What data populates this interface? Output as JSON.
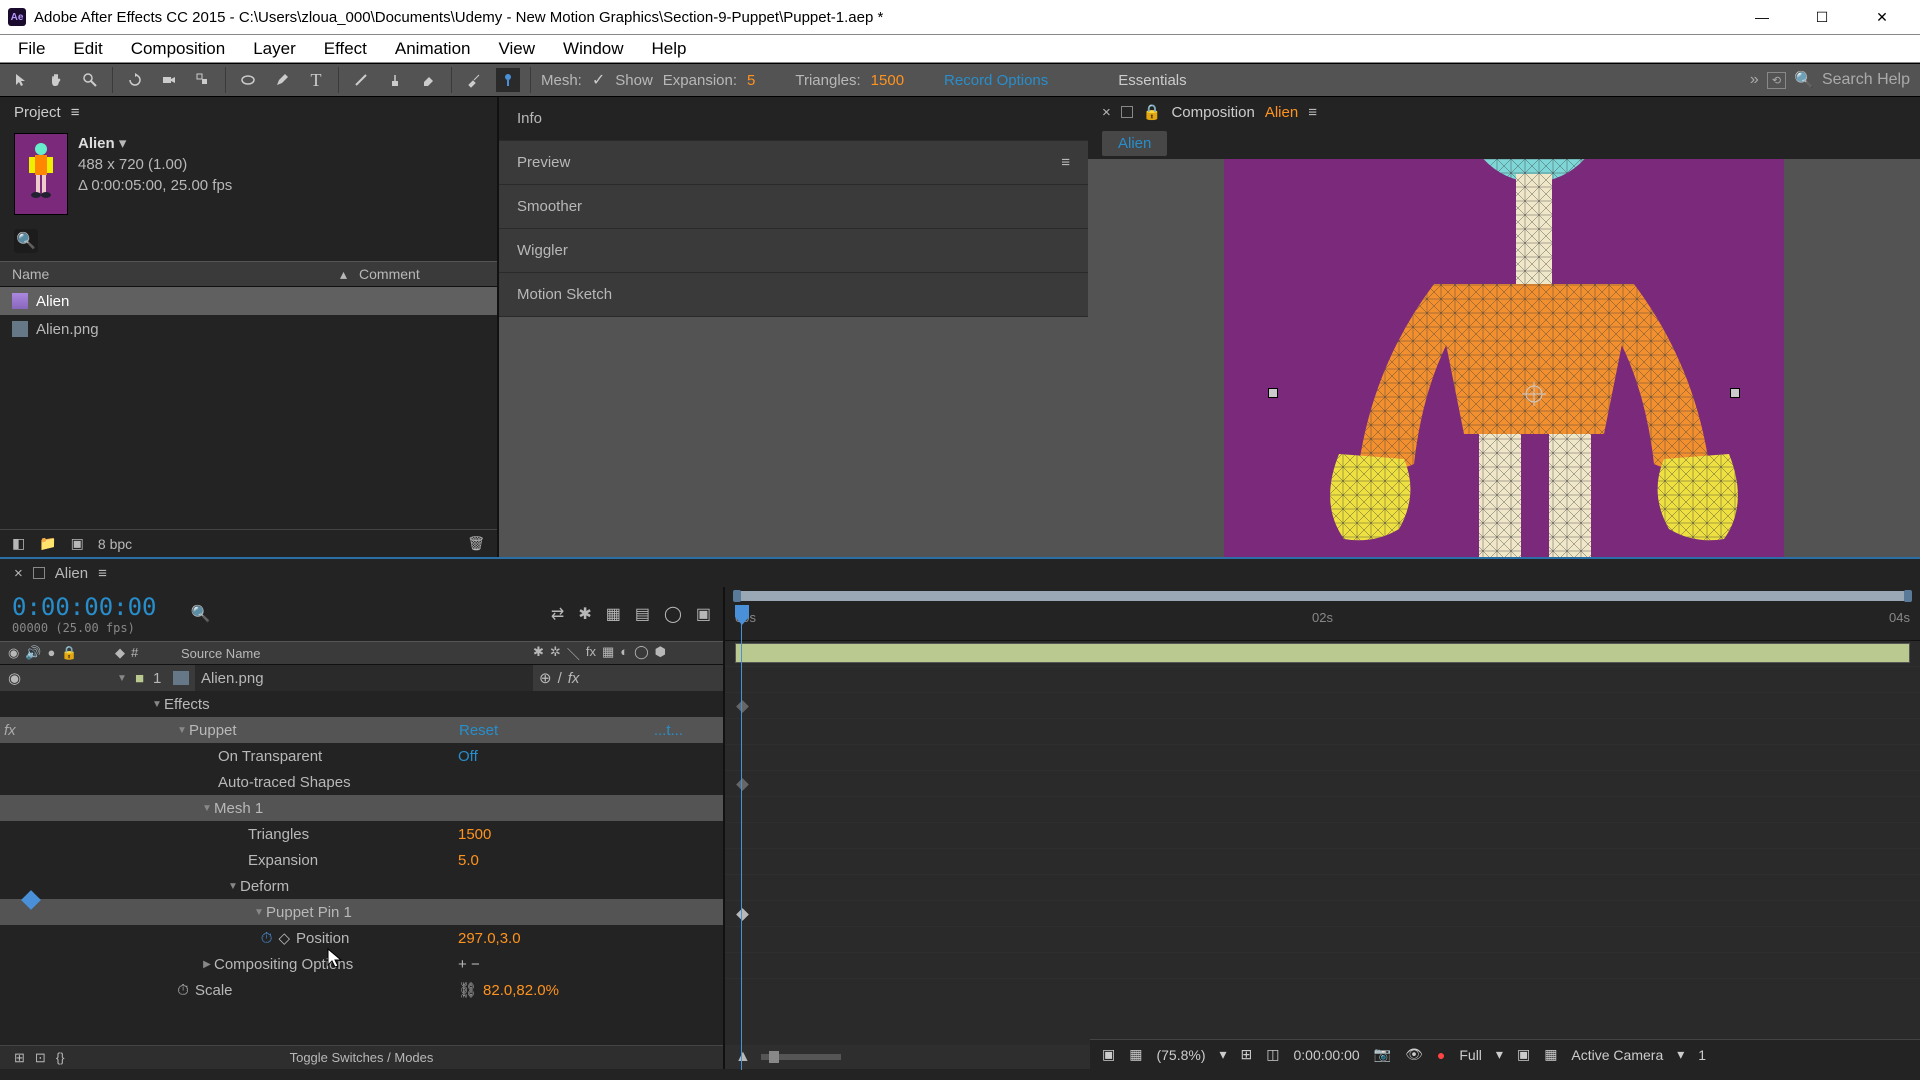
{
  "app": {
    "title": "Adobe After Effects CC 2015 - C:\\Users\\zloua_000\\Documents\\Udemy - New Motion Graphics\\Section-9-Puppet\\Puppet-1.aep *",
    "icon_text": "Ae"
  },
  "menu": [
    "File",
    "Edit",
    "Composition",
    "Layer",
    "Effect",
    "Animation",
    "View",
    "Window",
    "Help"
  ],
  "toolbar": {
    "mesh_label": "Mesh:",
    "mesh_show": "Show",
    "expansion_label": "Expansion:",
    "expansion_value": "5",
    "triangles_label": "Triangles:",
    "triangles_value": "1500",
    "record_options": "Record Options",
    "workspace": "Essentials",
    "search_placeholder": "Search Help"
  },
  "project": {
    "tab": "Project",
    "name": "Alien",
    "dims": "488 x 720 (1.00)",
    "duration": "Δ 0:00:05:00, 25.00 fps",
    "col_name": "Name",
    "col_comment": "Comment",
    "items": [
      {
        "name": "Alien",
        "sel": true
      },
      {
        "name": "Alien.png",
        "sel": false
      }
    ],
    "bpc": "8 bpc"
  },
  "mid_panels": [
    "Info",
    "Preview",
    "Smoother",
    "Wiggler",
    "Motion Sketch"
  ],
  "composition": {
    "label": "Composition",
    "name": "Alien",
    "tab": "Alien",
    "zoom": "(75.8%)",
    "time": "0:00:00:00",
    "res": "Full",
    "camera": "Active Camera",
    "views": "1"
  },
  "timeline": {
    "tab": "Alien",
    "timecode": "0:00:00:00",
    "frames": "00000 (25.00 fps)",
    "col_num": "#",
    "col_source": "Source Name",
    "ruler": [
      "00s",
      "02s",
      "04s"
    ],
    "layer_num": "1",
    "layer_name": "Alien.png",
    "effects": "Effects",
    "puppet": "Puppet",
    "reset": "Reset",
    "about": "...t...",
    "on_transparent": "On Transparent",
    "off": "Off",
    "auto_traced": "Auto-traced Shapes",
    "mesh1": "Mesh 1",
    "triangles": "Triangles",
    "triangles_val": "1500",
    "expansion": "Expansion",
    "expansion_val": "5.0",
    "deform": "Deform",
    "pin1": "Puppet Pin 1",
    "position": "Position",
    "position_val": "297.0,3.0",
    "comp_options": "Compositing Options",
    "scale": "Scale",
    "scale_val": "82.0,82.0%",
    "toggle": "Toggle Switches / Modes"
  }
}
